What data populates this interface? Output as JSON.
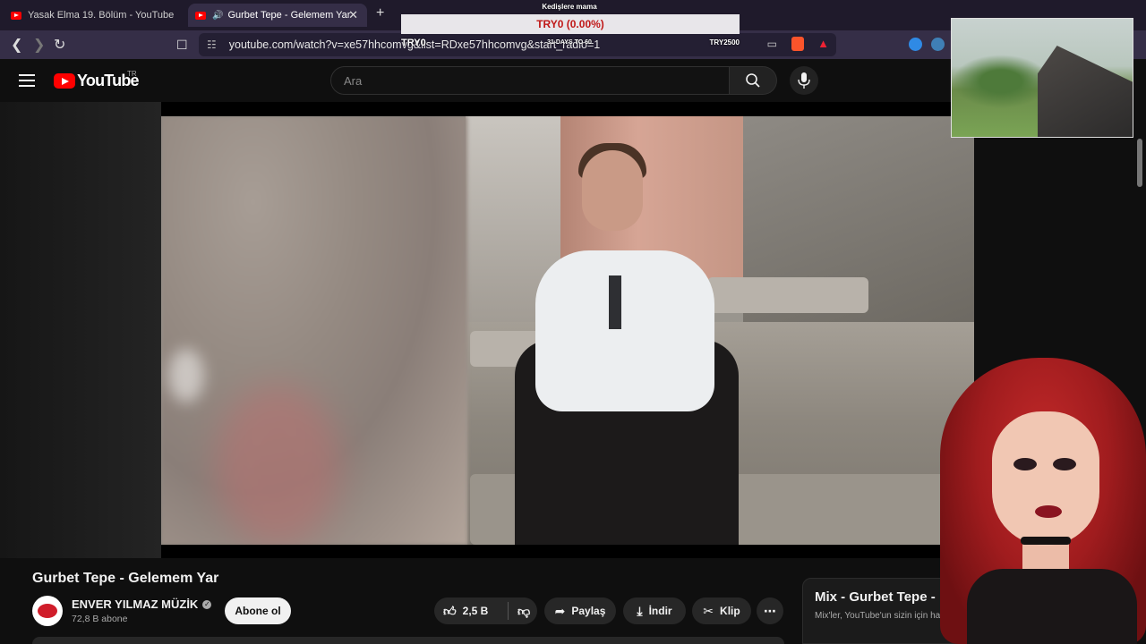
{
  "browser": {
    "tabs": [
      {
        "label": "Yasak Elma 19. Bölüm - YouTube",
        "active": false
      },
      {
        "label": "Gurbet Tepe - Gelemem Yar",
        "active": true
      }
    ],
    "new_tab_symbol": "+",
    "close_symbol": "✕",
    "url": "youtube.com/watch?v=xe57hhcomvg&list=RDxe57hhcomvg&start_radio=1"
  },
  "ticker": {
    "header": "Kedişlere mama",
    "price_line": "TRY0 (0.00%)",
    "left_label": "TRY0",
    "days_label": "31 DAYS TO 60",
    "right_label": "TRY2500"
  },
  "youtube": {
    "logo_text": "YouTube",
    "region": "TR",
    "search_placeholder": "Ara"
  },
  "video": {
    "title": "Gurbet Tepe - Gelemem Yar",
    "channel": "ENVER YILMAZ MÜZİK",
    "subscribers": "72,8 B abone",
    "subscribe_label": "Abone ol",
    "likes": "2,5 B",
    "share_label": "Paylaş",
    "download_label": "İndir",
    "clip_label": "Klip",
    "more_symbol": "⋯"
  },
  "mix": {
    "title": "Mix - Gurbet Tepe -",
    "subtitle": "Mix'ler, YouTube'un sizin için ha"
  },
  "colors": {
    "background": "#0f0f0f",
    "youtube_red": "#ff0000",
    "browser_frame": "#352e47",
    "ticker_price": "#c01818"
  }
}
